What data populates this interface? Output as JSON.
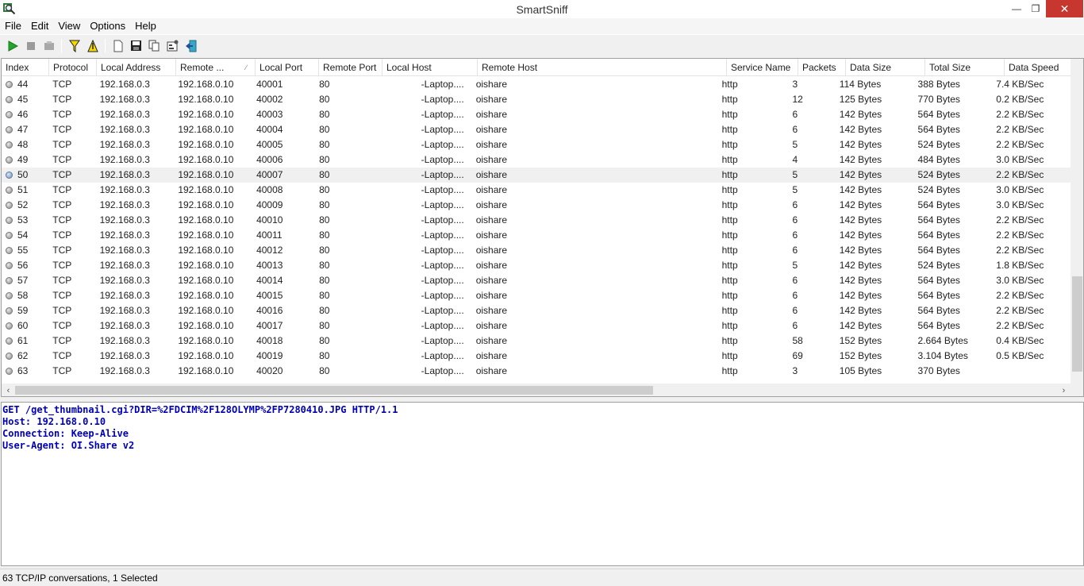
{
  "window": {
    "title": "SmartSniff",
    "minimize": "—",
    "maximize": "❐",
    "close": "✕"
  },
  "menu": [
    "File",
    "Edit",
    "View",
    "Options",
    "Help"
  ],
  "toolbar": {
    "icons": [
      "play-icon",
      "stop-icon",
      "open-capture-icon",
      "filter-icon",
      "filter-options-icon",
      "new-icon",
      "save-icon",
      "copy-icon",
      "properties-icon",
      "exit-icon"
    ]
  },
  "table": {
    "columns": [
      "Index",
      "Protocol",
      "Local Address",
      "Remote ...",
      "Local Port",
      "Remote Port",
      "Local Host",
      "Remote Host",
      "Service Name",
      "Packets",
      "Data Size",
      "Total Size",
      "Data Speed"
    ],
    "sort_indicator": "∕",
    "selected_index": "50",
    "rows": [
      [
        "44",
        "TCP",
        "192.168.0.3",
        "192.168.0.10",
        "40001",
        "80",
        "-Laptop....",
        "oishare",
        "http",
        "3",
        "114 Bytes",
        "388 Bytes",
        "7.4 KB/Sec"
      ],
      [
        "45",
        "TCP",
        "192.168.0.3",
        "192.168.0.10",
        "40002",
        "80",
        "-Laptop....",
        "oishare",
        "http",
        "12",
        "125 Bytes",
        "770 Bytes",
        "0.2 KB/Sec"
      ],
      [
        "46",
        "TCP",
        "192.168.0.3",
        "192.168.0.10",
        "40003",
        "80",
        "-Laptop....",
        "oishare",
        "http",
        "6",
        "142 Bytes",
        "564 Bytes",
        "2.2 KB/Sec"
      ],
      [
        "47",
        "TCP",
        "192.168.0.3",
        "192.168.0.10",
        "40004",
        "80",
        "-Laptop....",
        "oishare",
        "http",
        "6",
        "142 Bytes",
        "564 Bytes",
        "2.2 KB/Sec"
      ],
      [
        "48",
        "TCP",
        "192.168.0.3",
        "192.168.0.10",
        "40005",
        "80",
        "-Laptop....",
        "oishare",
        "http",
        "5",
        "142 Bytes",
        "524 Bytes",
        "2.2 KB/Sec"
      ],
      [
        "49",
        "TCP",
        "192.168.0.3",
        "192.168.0.10",
        "40006",
        "80",
        "-Laptop....",
        "oishare",
        "http",
        "4",
        "142 Bytes",
        "484 Bytes",
        "3.0 KB/Sec"
      ],
      [
        "50",
        "TCP",
        "192.168.0.3",
        "192.168.0.10",
        "40007",
        "80",
        "-Laptop....",
        "oishare",
        "http",
        "5",
        "142 Bytes",
        "524 Bytes",
        "2.2 KB/Sec"
      ],
      [
        "51",
        "TCP",
        "192.168.0.3",
        "192.168.0.10",
        "40008",
        "80",
        "-Laptop....",
        "oishare",
        "http",
        "5",
        "142 Bytes",
        "524 Bytes",
        "3.0 KB/Sec"
      ],
      [
        "52",
        "TCP",
        "192.168.0.3",
        "192.168.0.10",
        "40009",
        "80",
        "-Laptop....",
        "oishare",
        "http",
        "6",
        "142 Bytes",
        "564 Bytes",
        "3.0 KB/Sec"
      ],
      [
        "53",
        "TCP",
        "192.168.0.3",
        "192.168.0.10",
        "40010",
        "80",
        "-Laptop....",
        "oishare",
        "http",
        "6",
        "142 Bytes",
        "564 Bytes",
        "2.2 KB/Sec"
      ],
      [
        "54",
        "TCP",
        "192.168.0.3",
        "192.168.0.10",
        "40011",
        "80",
        "-Laptop....",
        "oishare",
        "http",
        "6",
        "142 Bytes",
        "564 Bytes",
        "2.2 KB/Sec"
      ],
      [
        "55",
        "TCP",
        "192.168.0.3",
        "192.168.0.10",
        "40012",
        "80",
        "-Laptop....",
        "oishare",
        "http",
        "6",
        "142 Bytes",
        "564 Bytes",
        "2.2 KB/Sec"
      ],
      [
        "56",
        "TCP",
        "192.168.0.3",
        "192.168.0.10",
        "40013",
        "80",
        "-Laptop....",
        "oishare",
        "http",
        "5",
        "142 Bytes",
        "524 Bytes",
        "1.8 KB/Sec"
      ],
      [
        "57",
        "TCP",
        "192.168.0.3",
        "192.168.0.10",
        "40014",
        "80",
        "-Laptop....",
        "oishare",
        "http",
        "6",
        "142 Bytes",
        "564 Bytes",
        "3.0 KB/Sec"
      ],
      [
        "58",
        "TCP",
        "192.168.0.3",
        "192.168.0.10",
        "40015",
        "80",
        "-Laptop....",
        "oishare",
        "http",
        "6",
        "142 Bytes",
        "564 Bytes",
        "2.2 KB/Sec"
      ],
      [
        "59",
        "TCP",
        "192.168.0.3",
        "192.168.0.10",
        "40016",
        "80",
        "-Laptop....",
        "oishare",
        "http",
        "6",
        "142 Bytes",
        "564 Bytes",
        "2.2 KB/Sec"
      ],
      [
        "60",
        "TCP",
        "192.168.0.3",
        "192.168.0.10",
        "40017",
        "80",
        "-Laptop....",
        "oishare",
        "http",
        "6",
        "142 Bytes",
        "564 Bytes",
        "2.2 KB/Sec"
      ],
      [
        "61",
        "TCP",
        "192.168.0.3",
        "192.168.0.10",
        "40018",
        "80",
        "-Laptop....",
        "oishare",
        "http",
        "58",
        "152 Bytes",
        "2.664 Bytes",
        "0.4 KB/Sec"
      ],
      [
        "62",
        "TCP",
        "192.168.0.3",
        "192.168.0.10",
        "40019",
        "80",
        "-Laptop....",
        "oishare",
        "http",
        "69",
        "152 Bytes",
        "3.104 Bytes",
        "0.5 KB/Sec"
      ],
      [
        "63",
        "TCP",
        "192.168.0.3",
        "192.168.0.10",
        "40020",
        "80",
        "-Laptop....",
        "oishare",
        "http",
        "3",
        "105 Bytes",
        "370 Bytes",
        ""
      ]
    ]
  },
  "scroll": {
    "left_arrow": "‹",
    "right_arrow": "›"
  },
  "detail": {
    "lines": [
      "GET /get_thumbnail.cgi?DIR=%2FDCIM%2F128OLYMP%2FP7280410.JPG HTTP/1.1",
      "Host: 192.168.0.10",
      "Connection: Keep-Alive",
      "User-Agent: OI.Share v2"
    ]
  },
  "status": {
    "text": "63 TCP/IP conversations, 1 Selected"
  },
  "colors": {
    "detail_text": "#0000b4",
    "close_button": "#c7372f",
    "selected_row": "#f0f0f0"
  }
}
